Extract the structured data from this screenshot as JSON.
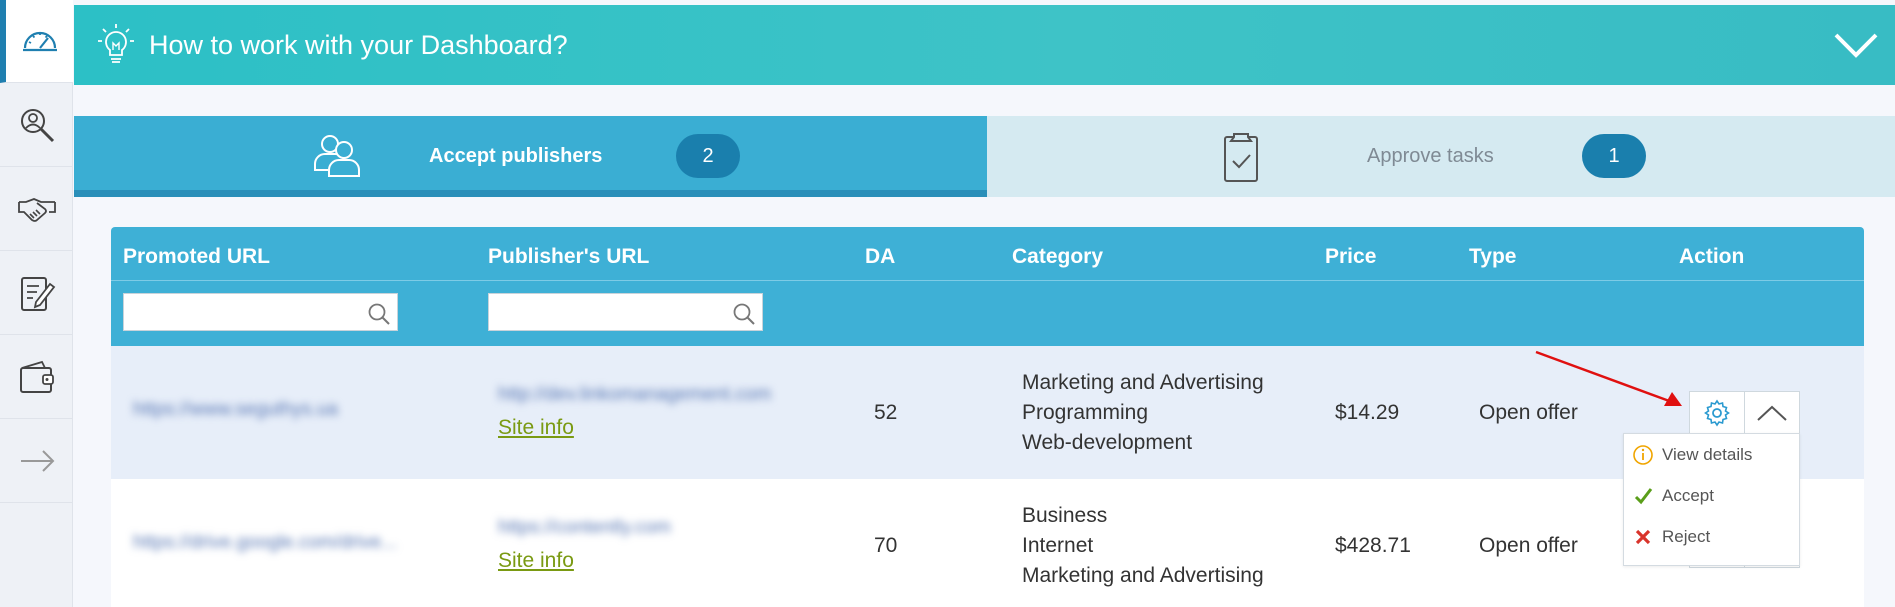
{
  "banner": {
    "title": "How to work with your Dashboard?"
  },
  "tabs": [
    {
      "label": "Accept publishers",
      "count": "2"
    },
    {
      "label": "Approve tasks",
      "count": "1"
    }
  ],
  "table": {
    "columns": [
      "Promoted URL",
      "Publisher's URL",
      "DA",
      "Category",
      "Price",
      "Type",
      "Action"
    ],
    "rows": [
      {
        "promoted_url": "https://www.seguthys.ua",
        "publisher_url": "http://dev.linkomanagement.com",
        "site_info": "Site info",
        "da": "52",
        "categories": [
          "Marketing and Advertising",
          "Programming",
          "Web-development"
        ],
        "price": "$14.29",
        "type": "Open offer"
      },
      {
        "promoted_url": "https://drive.google.com/drive...",
        "publisher_url": "https://contently.com",
        "site_info": "Site info",
        "da": "70",
        "categories": [
          "Business",
          "Internet",
          "Marketing and Advertising"
        ],
        "price": "$428.71",
        "type": "Open offer"
      }
    ]
  },
  "action_menu": {
    "items": [
      {
        "label": "View details",
        "icon": "info-icon"
      },
      {
        "label": "Accept",
        "icon": "check-icon"
      },
      {
        "label": "Reject",
        "icon": "x-icon"
      }
    ]
  },
  "colors": {
    "banner": "#38c0c6",
    "active_tab": "#3aaed3",
    "inactive_tab": "#d5eaf1",
    "table_header": "#3eb0d6",
    "badge": "#1a7fad",
    "site_info_link": "#7a9a12",
    "annotation_arrow": "#e01010"
  }
}
